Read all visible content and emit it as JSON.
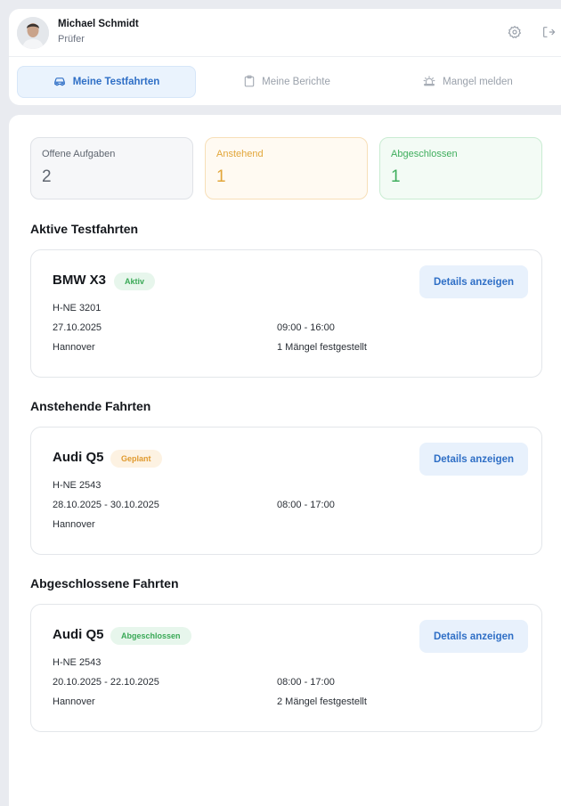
{
  "user": {
    "name": "Michael Schmidt",
    "role": "Prüfer"
  },
  "header_icons": [
    "settings-icon",
    "logout-icon"
  ],
  "nav": {
    "tabs": [
      {
        "label": "Meine Testfahrten",
        "icon": "car-icon",
        "active": true
      },
      {
        "label": "Meine Berichte",
        "icon": "clipboard-icon",
        "active": false
      },
      {
        "label": "Mangel melden",
        "icon": "siren-icon",
        "active": false
      }
    ]
  },
  "stats": [
    {
      "label": "Offene Aufgaben",
      "value": "2",
      "color": "#5f6670"
    },
    {
      "label": "Anstehend",
      "value": "1",
      "color": "#e2a63a"
    },
    {
      "label": "Abgeschlossen",
      "value": "1",
      "color": "#3fae5d"
    }
  ],
  "sections": {
    "active": {
      "title": "Aktive Testfahrten",
      "trip": {
        "car": "BMW X3",
        "badge": "Aktiv",
        "plate": "H-NE 3201",
        "date": "27.10.2025",
        "time": "09:00 - 16:00",
        "location": "Hannover",
        "defects": "1 Mängel festgestellt",
        "button": "Details anzeigen"
      }
    },
    "upcoming": {
      "title": "Anstehende Fahrten",
      "trip": {
        "car": "Audi Q5",
        "badge": "Geplant",
        "plate": "H-NE 2543",
        "date": "28.10.2025 - 30.10.2025",
        "time": "08:00 - 17:00",
        "location": "Hannover",
        "button": "Details anzeigen"
      }
    },
    "completed": {
      "title": "Abgeschlossene Fahrten",
      "trip": {
        "car": "Audi Q5",
        "badge": "Abgeschlossen",
        "plate": "H-NE 2543",
        "date": "20.10.2025 - 22.10.2025",
        "time": "08:00 - 17:00",
        "location": "Hannover",
        "defects": "2 Mängel festgestellt",
        "button": "Details anzeigen"
      }
    }
  },
  "colors": {
    "accent": "#2f6fc6",
    "accent_bg": "#e8f1fc",
    "active_badge": "#3aa957",
    "planned_badge": "#e09a2f"
  }
}
